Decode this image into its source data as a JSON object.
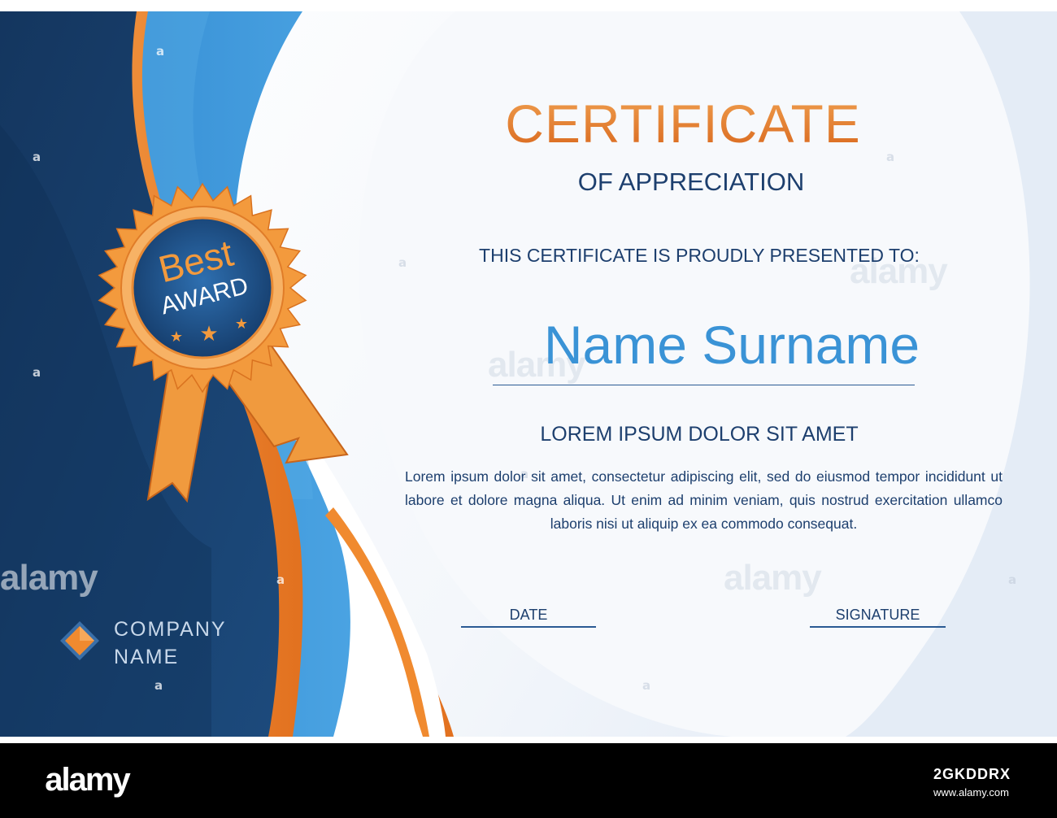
{
  "certificate": {
    "title": "CERTIFICATE",
    "subtitle": "OF APPRECIATION",
    "presented_to": "THIS CERTIFICATE IS PROUDLY PRESENTED TO:",
    "recipient_name": "Name Surname",
    "heading": "LOREM IPSUM DOLOR SIT AMET",
    "body": "Lorem ipsum dolor sit amet, consectetur adipiscing elit, sed do eiusmod tempor incididunt ut labore et dolore magna aliqua. Ut enim ad minim veniam, quis nostrud exercitation ullamco laboris nisi ut aliquip ex ea commodo consequat.",
    "date_label": "DATE",
    "signature_label": "SIGNATURE"
  },
  "badge": {
    "line1": "Best",
    "line2": "AWARD",
    "stars": 3
  },
  "company": {
    "line1": "COMPANY",
    "line2": "NAME"
  },
  "watermark": {
    "text": "alamy",
    "glyph": "a"
  },
  "footer": {
    "logo_text": "alamy",
    "site": "www.alamy.com",
    "image_id": "2GKDDRX"
  },
  "colors": {
    "navy": "#1d3f6e",
    "dark_blue": "#163c69",
    "bright_blue": "#3a93d6",
    "orange": "#e8832e"
  }
}
